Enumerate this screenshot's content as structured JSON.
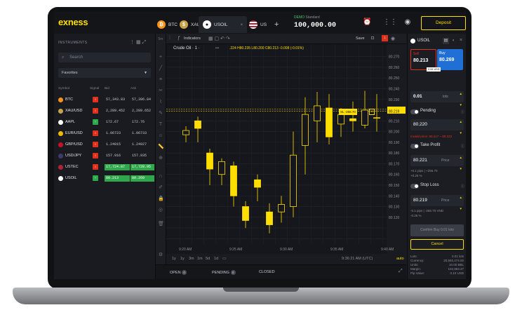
{
  "brand": "exness",
  "colors": {
    "accent": "#ffde02",
    "up": "#2ea84a",
    "down": "#e0301e",
    "candle": "#ffde02"
  },
  "tabs": [
    {
      "label": "BTC",
      "icon": "bitcoin-icon",
      "color": "#f7931a"
    },
    {
      "label": "XAU",
      "icon": "gold-icon",
      "color": "#c8a24a"
    },
    {
      "label": "USOIL",
      "icon": "oil-drop-icon",
      "color": "#222"
    },
    {
      "label": "US",
      "icon": "us-flag-icon",
      "color": "#b22234"
    }
  ],
  "account": {
    "mode": "DEMO",
    "type": "Standard",
    "balance": "100,000.00"
  },
  "deposit_label": "Deposit",
  "sidebar": {
    "title": "INSTRUMENTS",
    "search_placeholder": "Search",
    "filter": "Favorites",
    "columns": {
      "symbol": "Symbol",
      "signal": "Signal",
      "bid": "Bid",
      "ask": "Ask"
    },
    "rows": [
      {
        "symbol": "BTC",
        "signal": "down",
        "bid": "57,343.83",
        "ask": "57,396.84",
        "dot": "#f7931a",
        "hl": "none"
      },
      {
        "symbol": "XAU/USD",
        "signal": "down",
        "bid": "2,289.452",
        "ask": "2,289.652",
        "dot": "#c8a24a",
        "hl": "none"
      },
      {
        "symbol": "AAPL",
        "signal": "up",
        "bid": "172.67",
        "ask": "172.76",
        "dot": "#ffffff",
        "hl": "none"
      },
      {
        "symbol": "EUR/USD",
        "signal": "down",
        "bid": "1.06723",
        "ask": "1.06733",
        "dot": "#f1b900",
        "hl": "none"
      },
      {
        "symbol": "GBP/USD",
        "signal": "down",
        "bid": "1.24915",
        "ask": "1.24927",
        "dot": "#c8102e",
        "hl": "none"
      },
      {
        "symbol": "USD/JPY",
        "signal": "down",
        "bid": "157.916",
        "ask": "157.935",
        "dot": "#3c3b6e",
        "hl": "none"
      },
      {
        "symbol": "USTEC",
        "signal": "down",
        "bid": "17,724.87",
        "ask": "17,728.95",
        "dot": "#b22234",
        "hl": "green"
      },
      {
        "symbol": "USOIL",
        "signal": "up",
        "bid": "80.213",
        "ask": "80.269",
        "dot": "#ffffff",
        "hl": "green"
      }
    ]
  },
  "chart": {
    "symbol_line": "Crude Oil · 1 ·",
    "ohlc": ".224 H80.235 L80.200 C80.213 -0.008 (-0.01%)",
    "indicators_label": "Indicators",
    "save_label": "Save",
    "price_ticks": [
      "80.270",
      "80.260",
      "80.250",
      "80.240",
      "80.230",
      "80.221",
      "80.220",
      "80.219",
      "80.210",
      "80.200",
      "80.190",
      "80.180",
      "80.170",
      "80.160",
      "80.150",
      "80.140",
      "80.130",
      "80.120"
    ],
    "time_ticks": [
      "9:20 AM",
      "9:25 AM",
      "9:30 AM",
      "9:35 AM",
      "9:40 AM"
    ],
    "timeframes": [
      "1y",
      "1y",
      "3m",
      "1m",
      "5d",
      "1d"
    ],
    "clock": "9:36:21 AM (UTC)",
    "auto_label": "auto",
    "order_line": {
      "tag": "SL",
      "value": "-256.70",
      "close": "×"
    }
  },
  "chart_data": {
    "type": "candlestick",
    "x": [
      "9:20",
      "9:21",
      "9:22",
      "9:23",
      "9:24",
      "9:25",
      "9:26",
      "9:27",
      "9:28",
      "9:29",
      "9:30",
      "9:31",
      "9:32",
      "9:33",
      "9:34",
      "9:35",
      "9:36"
    ],
    "open": [
      80.197,
      80.21,
      80.18,
      80.16,
      80.168,
      80.13,
      80.155,
      80.125,
      80.125,
      80.13,
      80.187,
      80.21,
      80.222,
      80.207,
      80.212,
      80.206,
      80.213
    ],
    "close": [
      80.201,
      80.203,
      80.165,
      80.172,
      80.14,
      80.117,
      80.148,
      80.113,
      80.132,
      80.178,
      80.216,
      80.224,
      80.195,
      80.216,
      80.21,
      80.22,
      80.213
    ],
    "high": [
      80.205,
      80.214,
      80.184,
      80.175,
      80.172,
      80.135,
      80.16,
      80.133,
      80.14,
      80.2,
      80.232,
      80.237,
      80.235,
      80.222,
      80.228,
      80.238,
      80.235
    ],
    "low": [
      80.19,
      80.19,
      80.15,
      80.15,
      80.13,
      80.11,
      80.135,
      80.105,
      80.115,
      80.12,
      80.16,
      80.19,
      80.188,
      80.195,
      80.2,
      80.203,
      80.2
    ],
    "ylim": [
      80.095,
      80.275
    ],
    "price_levels": [
      80.221,
      80.219
    ],
    "grid": true,
    "xlabel": "",
    "ylabel": ""
  },
  "panel": {
    "symbol": "USOIL",
    "sell_label": "Sell",
    "sell_price": "80.213",
    "buy_label": "Buy",
    "buy_price": "80.269",
    "spread": "0.06 USD",
    "volume": "0.01",
    "volume_unit": "lots",
    "pending_label": "Pending",
    "pending_price": "80.220",
    "invalid_text": "Invalid price: 80.217 – 80.223",
    "take_profit_label": "Take Profit",
    "tp_price": "80.221",
    "tp_unit": "Price",
    "tp_info1": "+0.1 pips  |  +256.70",
    "tp_info2": "+0.26 %",
    "stop_loss_label": "Stop Loss",
    "sl_price": "80.219",
    "sl_unit": "Price",
    "sl_info1": "-0.1 pips  |  -256.70 VND",
    "sl_info2": "-0.26 %",
    "confirm_label": "Confirm Buy 0.01 lots",
    "cancel_label": "Cancel",
    "summary": [
      {
        "k": "Lots:",
        "v": "0.01 lots"
      },
      {
        "k": "Currency:",
        "v": "20,592,474.00"
      },
      {
        "k": "Units:",
        "v": "10.00 BBL"
      },
      {
        "k": "Margin:",
        "v": "102,963.27"
      },
      {
        "k": "Pip Value:",
        "v": "0.10 USD"
      }
    ]
  },
  "bottom": {
    "open": "OPEN",
    "open_count": "0",
    "pending": "PENDING",
    "pending_count": "0",
    "closed": "CLOSED"
  }
}
